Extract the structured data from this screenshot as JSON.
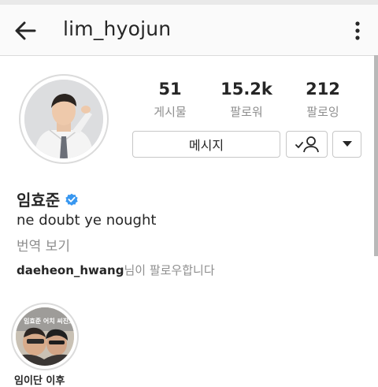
{
  "header": {
    "username": "lim_hyojun",
    "back_icon": "arrow-left-icon",
    "more_icon": "vertical-dots-icon"
  },
  "profile": {
    "stats": [
      {
        "value": "51",
        "label": "게시물"
      },
      {
        "value": "15.2k",
        "label": "팔로워"
      },
      {
        "value": "212",
        "label": "팔로잉"
      }
    ],
    "message_button": "메시지",
    "following_icon": "person-check-icon",
    "dropdown_icon": "caret-down-icon",
    "name": "임효준",
    "verified_icon": "verified-badge-icon",
    "verified_color": "#3897f0",
    "bio": "ne doubt ye nought",
    "translate_link": "번역 보기",
    "followed_by_user": "daeheon_hwang",
    "followed_by_suffix": "님이 팔로우합니다"
  },
  "highlights": [
    {
      "image_text": "임효준 어치 씨진도",
      "label": "임이단 이후"
    }
  ]
}
